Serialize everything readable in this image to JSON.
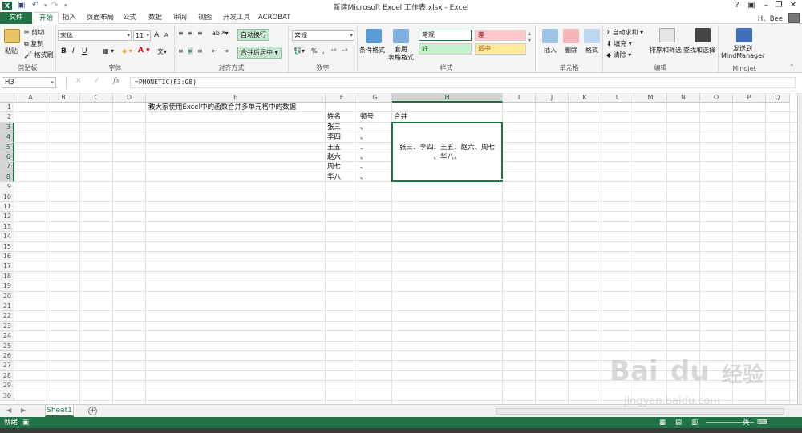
{
  "window": {
    "title": "新建Microsoft Excel 工作表.xlsx - Excel",
    "help": "?",
    "account": "H、Bee"
  },
  "tabs": [
    "文件",
    "开始",
    "插入",
    "页面布局",
    "公式",
    "数据",
    "审阅",
    "视图",
    "开发工具",
    "ACROBAT"
  ],
  "ribbon": {
    "clipboard": {
      "label": "剪贴板",
      "paste": "粘贴",
      "cut": "剪切",
      "copy": "复制",
      "format_painter": "格式刷"
    },
    "font": {
      "label": "字体",
      "name": "宋体",
      "size": "11",
      "bold": "B",
      "italic": "I",
      "underline": "U",
      "grow": "A",
      "shrink": "A"
    },
    "alignment": {
      "label": "对齐方式",
      "wrap": "自动换行",
      "merge": "合并后居中"
    },
    "number": {
      "label": "数字",
      "format": "常规",
      "percent": "%"
    },
    "styles": {
      "label": "样式",
      "conditional": "条件格式",
      "table": "套用\n表格格式",
      "normal": "常规",
      "bad": "差",
      "good": "好",
      "neutral": "适中"
    },
    "cells": {
      "label": "单元格",
      "insert": "插入",
      "delete": "删除",
      "format": "格式"
    },
    "editing": {
      "label": "编辑",
      "autosum": "自动求和",
      "fill": "填充",
      "clear": "清除",
      "sort": "排序和筛选",
      "find": "查找和选择"
    },
    "mindjet": {
      "label": "Mindjet",
      "send": "发送到",
      "send2": "MindManager"
    },
    "colors": {
      "accent": "#217346",
      "bad_bg": "#ffc7ce",
      "good_bg": "#c6efce",
      "neutral_bg": "#ffeb9c"
    }
  },
  "formula_bar": {
    "name_box": "H3",
    "fx": "fx",
    "formula": "=PHONETIC(F3:G8)"
  },
  "columns": [
    "A",
    "B",
    "C",
    "D",
    "E",
    "F",
    "G",
    "H",
    "I",
    "J",
    "K",
    "L",
    "M",
    "N",
    "O",
    "P",
    "Q"
  ],
  "rows": [
    "1",
    "2",
    "3",
    "4",
    "5",
    "6",
    "7",
    "8",
    "9",
    "10",
    "11",
    "12",
    "13",
    "14",
    "15",
    "16",
    "17",
    "18",
    "19",
    "20",
    "21",
    "22",
    "23",
    "24",
    "25",
    "26",
    "27",
    "28",
    "29",
    "30"
  ],
  "cells": {
    "E1": "教大家使用Excel中的函数合并多单元格中的数据",
    "F2": "姓名",
    "G2": "顿号",
    "H2": "合并",
    "F3": "张三",
    "G3": "、",
    "F4": "李四",
    "G4": "、",
    "F5": "王五",
    "G5": "、",
    "F6": "赵六",
    "G6": "、",
    "F7": "周七",
    "G7": "、",
    "F8": "华八",
    "G8": "、",
    "H3_line1": "张三、李四、王五、赵六、周七",
    "H3_line2": "、华八、"
  },
  "sheets": [
    "Sheet1"
  ],
  "status": {
    "ready": "就绪",
    "ime": "英"
  },
  "watermark": {
    "brand": "Bai",
    "brand2": "du",
    "cn": "经验",
    "url": "jingyan.baidu.com"
  }
}
